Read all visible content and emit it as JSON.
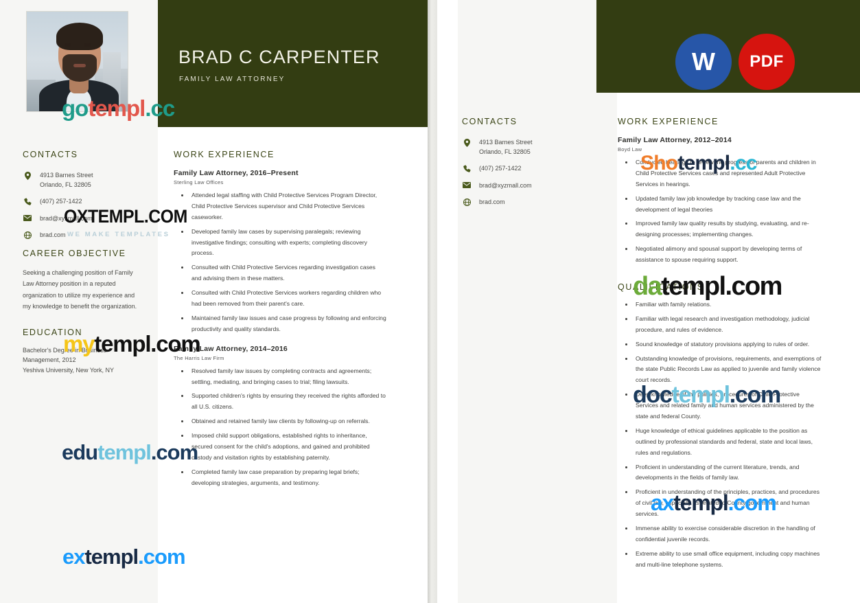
{
  "document": {
    "name": "BRAD C CARPENTER",
    "role": "FAMILY LAW ATTORNEY"
  },
  "page1": {
    "contacts": {
      "heading": "CONTACTS",
      "items": [
        {
          "icon": "location-pin-icon",
          "line1": "4913 Barnes Street",
          "line2": "Orlando, FL 32805"
        },
        {
          "icon": "phone-icon",
          "line1": "(407) 257-1422",
          "line2": ""
        },
        {
          "icon": "envelope-icon",
          "line1": "brad@xyzmall.com",
          "line2": ""
        },
        {
          "icon": "globe-icon",
          "line1": "brad.com",
          "line2": ""
        }
      ]
    },
    "career_objective": {
      "heading": "CAREER OBJECTIVE",
      "text": "Seeking a challenging position of Family Law Attorney position in a reputed organization to utilize my experience and my knowledge to benefit the organization."
    },
    "education": {
      "heading": "EDUCATION",
      "degree": "Bachelor's Degree in Business Management, 2012",
      "school": "Yeshiva University, New York, NY"
    },
    "work_experience": {
      "heading": "WORK EXPERIENCE",
      "jobs": [
        {
          "title": "Family Law Attorney, 2016–Present",
          "org": "Sterling Law Offices",
          "bullets": [
            "Attended legal staffing with Child Protective Services Program Director, Child Protective Services supervisor and Child Protective Services caseworker.",
            "Developed family law cases by supervising paralegals; reviewing investigative findings; consulting with experts; completing discovery process.",
            "Consulted with Child Protective Services regarding investigation cases and advising them in these matters.",
            "Consulted with Child Protective Services workers regarding children who had been removed from their parent's care.",
            "Maintained family law issues and case progress by following and enforcing productivity and quality standards."
          ]
        },
        {
          "title": "Family Law Attorney, 2014–2016",
          "org": "The Harris Law Firm",
          "bullets": [
            "Resolved family law issues by completing contracts and agreements; settling, mediating, and bringing cases to trial; filing lawsuits.",
            "Supported children's rights by ensuring they received the rights afforded to all U.S. citizens.",
            "Obtained and retained family law clients by following-up on referrals.",
            "Imposed child support obligations, established rights to inheritance, secured consent for the child's adoptions, and gained and prohibited custody and visitation rights by establishing paternity.",
            "Completed family law case preparation by preparing legal briefs; developing strategies, arguments, and testimony."
          ]
        }
      ]
    }
  },
  "page2": {
    "badges": [
      {
        "name": "word-badge",
        "label": "W",
        "color": "#2756a8"
      },
      {
        "name": "pdf-badge",
        "label": "PDF",
        "color": "#d6140f"
      }
    ],
    "contacts": {
      "heading": "CONTACTS",
      "items": [
        {
          "icon": "location-pin-icon",
          "line1": "4913 Barnes Street",
          "line2": "Orlando, FL 32805"
        },
        {
          "icon": "phone-icon",
          "line1": "(407) 257-1422",
          "line2": ""
        },
        {
          "icon": "envelope-icon",
          "line1": "brad@xyzmall.com",
          "line2": ""
        },
        {
          "icon": "globe-icon",
          "line1": "brad.com",
          "line2": ""
        }
      ]
    },
    "work_experience": {
      "heading": "WORK EXPERIENCE",
      "job": {
        "title": "Family Law Attorney, 2012–2014",
        "org": "Boyd Law",
        "bullets": [
          "Conducted hearings to review the progress of parents and children in Child Protective Services cases and represented Adult Protective Services in hearings.",
          "Updated family law job knowledge by tracking case law and the development of legal theories",
          "Improved family law quality results by studying, evaluating, and re-designing processes; implementing changes.",
          "Negotiated alimony and spousal support by developing terms of assistance to spouse requiring support."
        ]
      }
    },
    "qualifications": {
      "heading": "QUALIFICATIONS",
      "bullets": [
        "Familiar with family relations.",
        "Familiar with legal research and investigation methodology, judicial procedure, and rules of evidence.",
        "Sound knowledge of statutory provisions applying to rules of order.",
        "Outstanding knowledge of provisions, requirements, and exemptions of the state Public Records Law as applied to juvenile and family violence court records.",
        "Deep knowledge of the policies, procedures of Child Protective Services and related family and human services administered by the state and federal County.",
        "Huge knowledge of ethical guidelines applicable to the position as outlined by professional standards and federal, state and local laws, rules and regulations.",
        "Proficient in understanding of the current literature, trends, and developments in the fields of family law.",
        "Proficient in understanding of the principles, practices, and procedures of civil law, especially as related to County government and human services.",
        "Immense ability to exercise considerable discretion in the handling of confidential juvenile records.",
        "Extreme ability to use small office equipment, including copy machines and multi-line telephone systems."
      ]
    }
  },
  "watermarks": {
    "gotempl": {
      "a": "go",
      "b": "templ",
      "c": ".cc"
    },
    "oxtempl": {
      "main": "OXTEMPL.COM",
      "sub": "WE MAKE TEMPLATES"
    },
    "mytempl": {
      "a": "my",
      "b": "templ.com"
    },
    "edutempl": {
      "a": "edu",
      "b": "templ",
      "c": ".com"
    },
    "extempl": {
      "a": "ex",
      "b": "templ",
      "c": ".com"
    },
    "shotempl": {
      "a": "Sho",
      "b": "templ",
      "c": ".cc"
    },
    "datempl": {
      "a": "da",
      "b": "templ.com"
    },
    "doctempl": {
      "a": "doc",
      "b": "templ",
      "c": ".com"
    },
    "axtempl": {
      "a": "ax",
      "b": "templ",
      "c": ".com"
    }
  }
}
